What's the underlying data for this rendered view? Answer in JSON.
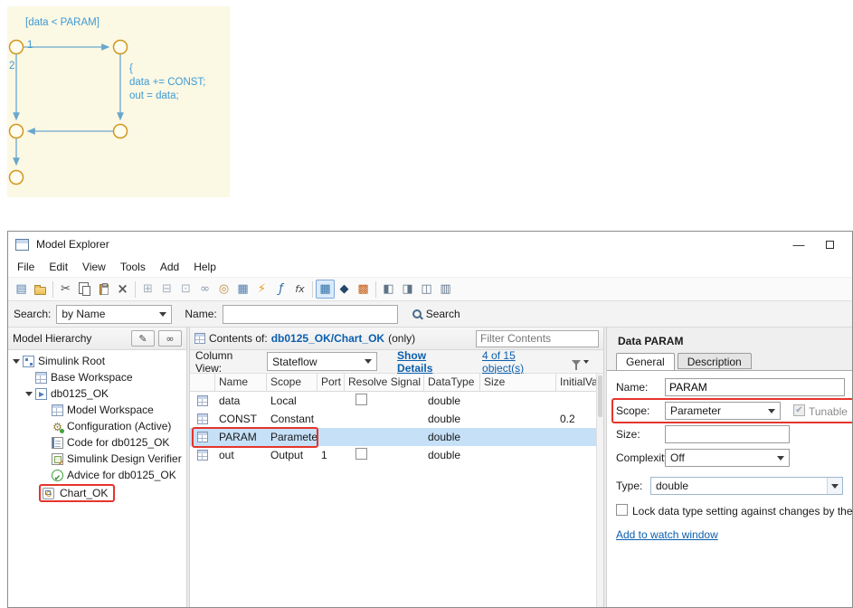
{
  "chart": {
    "condition": "[data < PARAM]",
    "label_1": "1",
    "label_2": "2",
    "action": "{\ndata += CONST;\nout = data;"
  },
  "window": {
    "title": "Model Explorer",
    "minimize_glyph": "—"
  },
  "menu": {
    "items": [
      "File",
      "Edit",
      "View",
      "Tools",
      "Add",
      "Help"
    ]
  },
  "search_bar": {
    "search_label": "Search:",
    "mode": "by Name",
    "name_label": "Name:",
    "name_value": "",
    "button": "Search"
  },
  "hierarchy": {
    "title": "Model Hierarchy",
    "items": [
      "Simulink Root",
      "Base Workspace",
      "db0125_OK",
      "Model Workspace",
      "Configuration (Active)",
      "Code for db0125_OK",
      "Simulink Design Verifier",
      "Advice for db0125_OK",
      "Chart_OK"
    ]
  },
  "contents": {
    "label": "Contents of:",
    "path": "db0125_OK/Chart_OK",
    "suffix": "(only)",
    "filter_placeholder": "Filter Contents",
    "column_view_label": "Column View:",
    "column_view": "Stateflow",
    "show_details": "Show Details",
    "object_count": "4 of 15 object(s)",
    "columns": [
      "Name",
      "Scope",
      "Port",
      "Resolve Signal",
      "DataType",
      "Size",
      "InitialValu"
    ],
    "rows": [
      {
        "name": "data",
        "scope": "Local",
        "port": "",
        "datatype": "double",
        "size": "",
        "initial": ""
      },
      {
        "name": "CONST",
        "scope": "Constant",
        "port": "",
        "datatype": "double",
        "size": "",
        "initial": "0.2"
      },
      {
        "name": "PARAM",
        "scope": "Parameter",
        "port": "",
        "datatype": "double",
        "size": "",
        "initial": ""
      },
      {
        "name": "out",
        "scope": "Output",
        "port": "1",
        "datatype": "double",
        "size": "",
        "initial": ""
      }
    ]
  },
  "dialog": {
    "title": "Data PARAM",
    "tabs": [
      "General",
      "Description"
    ],
    "name_label": "Name:",
    "name_value": "PARAM",
    "scope_label": "Scope:",
    "scope_value": "Parameter",
    "tunable_label": "Tunable",
    "size_label": "Size:",
    "size_value": "",
    "complexity_label": "Complexity:",
    "complexity_value": "Off",
    "type_label": "Type:",
    "type_value": "double",
    "lock_label": "Lock data type setting against changes by the fixe",
    "watch_link": "Add to watch window"
  },
  "icons": {
    "new-model-icon": "▤",
    "open-folder-icon": "folder-shape",
    "cut-icon": "✂",
    "copy-icon": "two-pages-shape",
    "paste-icon": "clipboard-shape",
    "delete-icon": "×",
    "add-state-icon": "⊞",
    "add-box-icon": "⊟",
    "add-frame-icon": "⊡",
    "add-link-icon": "∞",
    "add-junction-icon": "◎",
    "add-data-icon": "▦",
    "add-event-icon": "⚡",
    "add-function-icon": "ƒ",
    "add-matlab-function-icon": "fx",
    "column-view-icon": "▦",
    "simulink-icon": "◆",
    "stateflow-icon": "▩",
    "hierarchy-pane-icon": "◧",
    "contents-pane-icon": "◨",
    "dialog-pane-icon": "◫",
    "layout-pane-icon": "▥",
    "search-icon": "magnifier-shape",
    "filter-icon": "funnel-shape",
    "pencil-icon": "✎",
    "find-icon": "∞"
  }
}
